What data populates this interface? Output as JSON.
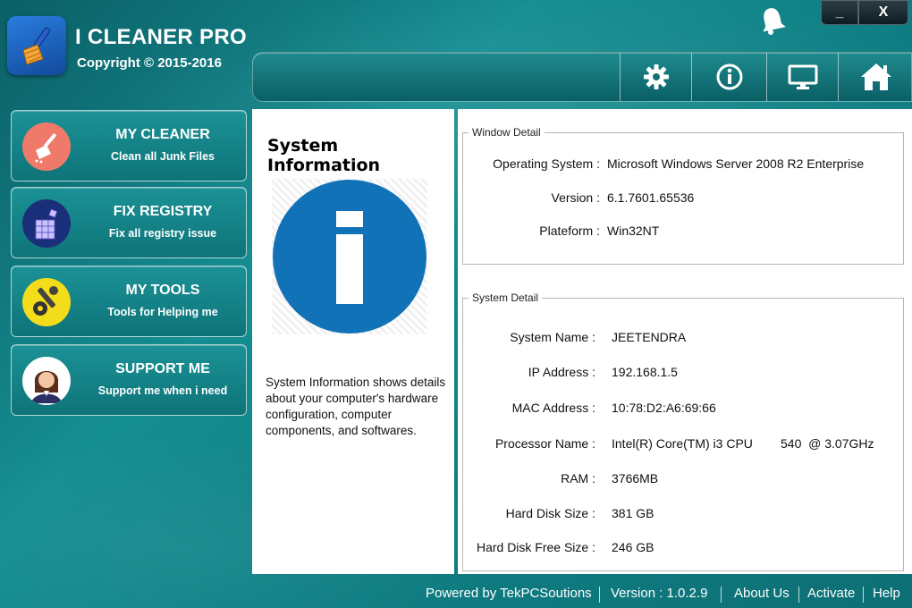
{
  "app": {
    "title": "I CLEANER PRO",
    "copyright": "Copyright © 2015-2016"
  },
  "window_controls": {
    "minimize": "_",
    "close": "X"
  },
  "toolbar": {
    "buttons": [
      "gear-icon",
      "info-icon",
      "monitor-icon",
      "home-icon"
    ]
  },
  "sidebar": {
    "items": [
      {
        "title": "MY CLEANER",
        "subtitle": "Clean all Junk Files",
        "icon": "broom-icon",
        "icon_bg": "#f07a6a"
      },
      {
        "title": "FIX REGISTRY",
        "subtitle": "Fix all registry issue",
        "icon": "registry-cubes-icon",
        "icon_bg": "#1a2f7a"
      },
      {
        "title": "MY TOOLS",
        "subtitle": "Tools for Helping me",
        "icon": "wrench-gear-icon",
        "icon_bg": "#f3dd1a"
      },
      {
        "title": "SUPPORT ME",
        "subtitle": "Support me when i need",
        "icon": "support-agent-icon",
        "icon_bg": "#ffffff"
      }
    ]
  },
  "info_panel": {
    "title": "System Information",
    "description": "System Information shows details about your computer's hardware configuration, computer components, and softwares.",
    "graphic_color": "#1272b8"
  },
  "window_detail": {
    "legend": "Window Detail",
    "rows": [
      {
        "label": "Operating System :",
        "value": "Microsoft Windows Server 2008 R2 Enterprise"
      },
      {
        "label": "Version :",
        "value": "6.1.7601.65536"
      },
      {
        "label": "Plateform :",
        "value": "Win32NT"
      }
    ]
  },
  "system_detail": {
    "legend": "System Detail",
    "rows": [
      {
        "label": "System Name :",
        "value": "JEETENDRA"
      },
      {
        "label": "IP Address :",
        "value": "192.168.1.5"
      },
      {
        "label": "MAC Address :",
        "value": "10:78:D2:A6:69:66"
      },
      {
        "label": "Processor Name :",
        "value": "Intel(R) Core(TM) i3 CPU        540  @ 3.07GHz"
      },
      {
        "label": "RAM :",
        "value": "3766MB"
      },
      {
        "label": "Hard Disk Size :",
        "value": "381 GB"
      },
      {
        "label": "Hard Disk Free Size :",
        "value": "246 GB"
      }
    ]
  },
  "statusbar": {
    "powered_by": "Powered by TekPCSoutions",
    "version": "Version : 1.0.2.9",
    "about": "About Us",
    "activate": "Activate",
    "help": "Help"
  }
}
